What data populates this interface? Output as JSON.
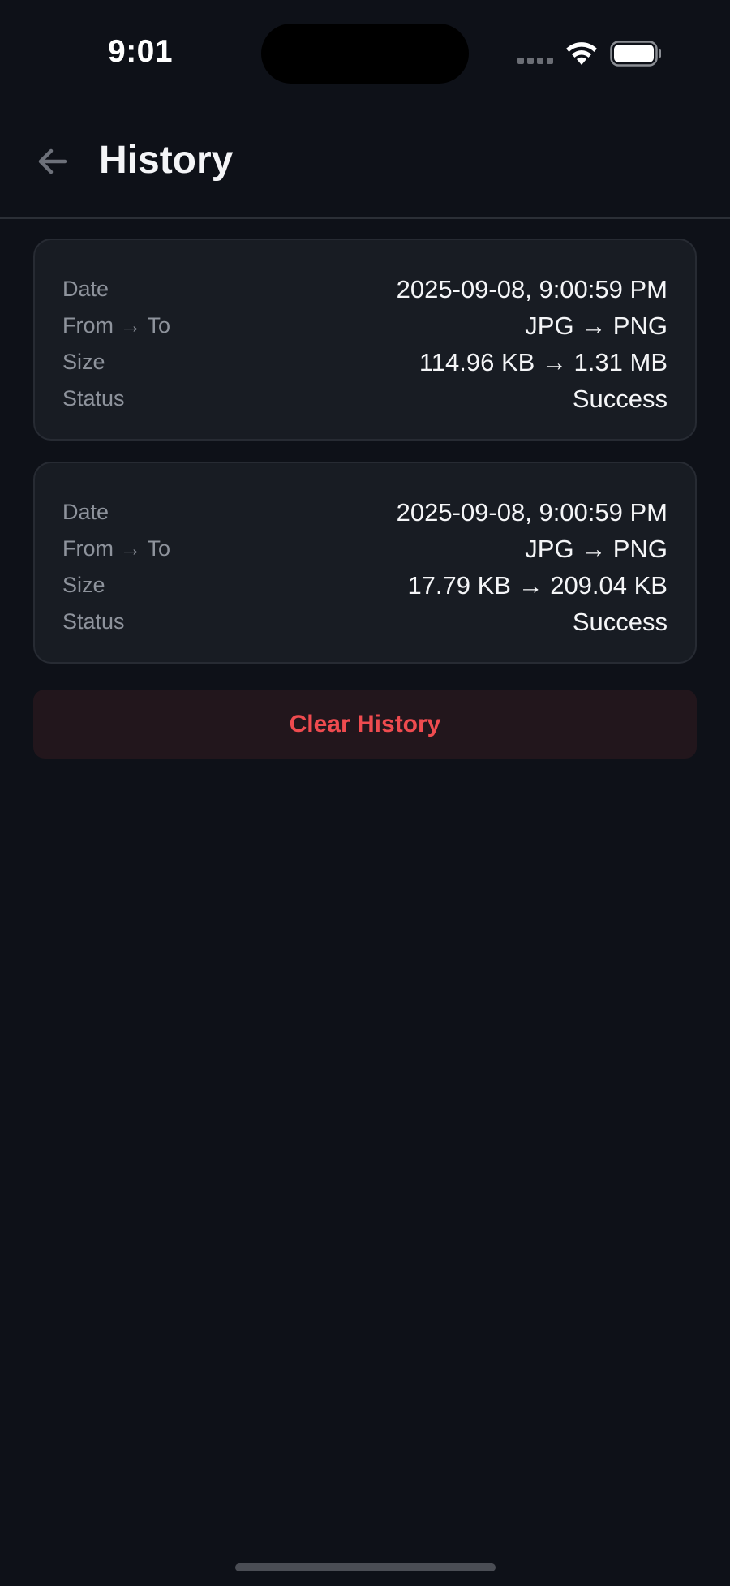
{
  "status_bar": {
    "time": "9:01"
  },
  "header": {
    "title": "History",
    "back_icon": "arrow-left-icon"
  },
  "history": [
    {
      "rows": [
        {
          "label": "Date",
          "value": "2025-09-08, 9:00:59 PM"
        },
        {
          "label": "From → To",
          "value": "JPG → PNG"
        },
        {
          "label": "Size",
          "value": "114.96 KB → 1.31 MB"
        },
        {
          "label": "Status",
          "value": "Success"
        }
      ]
    },
    {
      "rows": [
        {
          "label": "Date",
          "value": "2025-09-08, 9:00:59 PM"
        },
        {
          "label": "From → To",
          "value": "JPG → PNG"
        },
        {
          "label": "Size",
          "value": "17.79 KB → 209.04 KB"
        },
        {
          "label": "Status",
          "value": "Success"
        }
      ]
    }
  ],
  "actions": {
    "clear_label": "Clear History"
  },
  "colors": {
    "background": "#0e1118",
    "card": "#181c23",
    "danger": "#ef4b4f",
    "muted_text": "#8e939c"
  }
}
